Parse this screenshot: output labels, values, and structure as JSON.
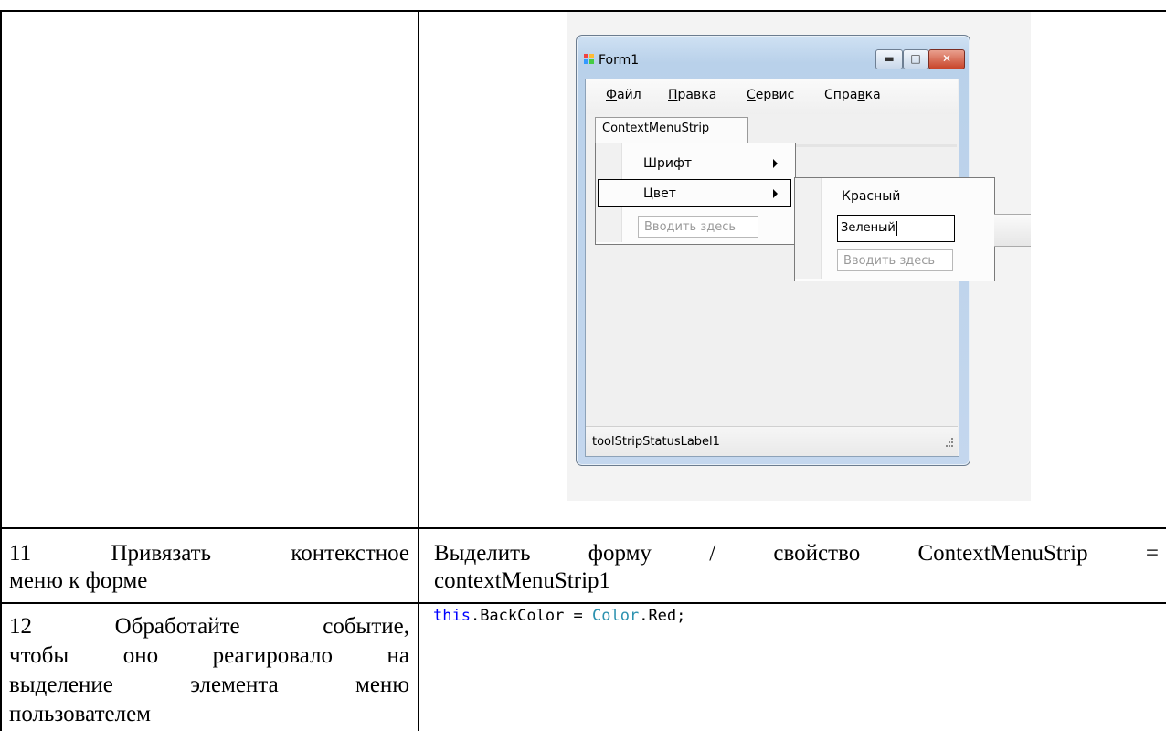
{
  "screenshot": {
    "window_title": "Form1",
    "menu": [
      {
        "label": "Файл",
        "mnemonic": "Ф",
        "rest": "айл"
      },
      {
        "label": "Правка",
        "mnemonic": "П",
        "rest": "равка"
      },
      {
        "label": "Сервис",
        "mnemonic": "С",
        "rest": "ервис"
      },
      {
        "label": "Справка",
        "pre": "Спра",
        "mnemonic": "в",
        "rest": "ка"
      }
    ],
    "context_menu_tab": "ContextMenuStrip",
    "context_items": [
      "Шрифт",
      "Цвет"
    ],
    "type_here": "Вводить здесь",
    "submenu_items": [
      "Красный"
    ],
    "submenu_edit_value": "Зеленый",
    "status_label": "toolStripStatusLabel1",
    "button_icons": [
      "minimize-icon",
      "maximize-icon",
      "close-icon"
    ]
  },
  "rows": [
    {
      "left": [
        "11    Привязать    контекстное",
        "меню к форме"
      ],
      "right": [
        "Выделить   форму   /   свойство   ContextMenuStrip   =",
        "contextMenuStrip1"
      ]
    },
    {
      "left": [
        "12    Обработайте    событие,",
        "чтобы  оно  реагировало  на",
        "выделение   элемента   меню",
        "пользователем"
      ],
      "code": {
        "keyword": "this",
        "middle": ".BackColor = ",
        "type": "Color",
        "end": ".Red;"
      }
    }
  ],
  "colors": {
    "keyword": "#0000ff",
    "type": "#2b91af"
  }
}
